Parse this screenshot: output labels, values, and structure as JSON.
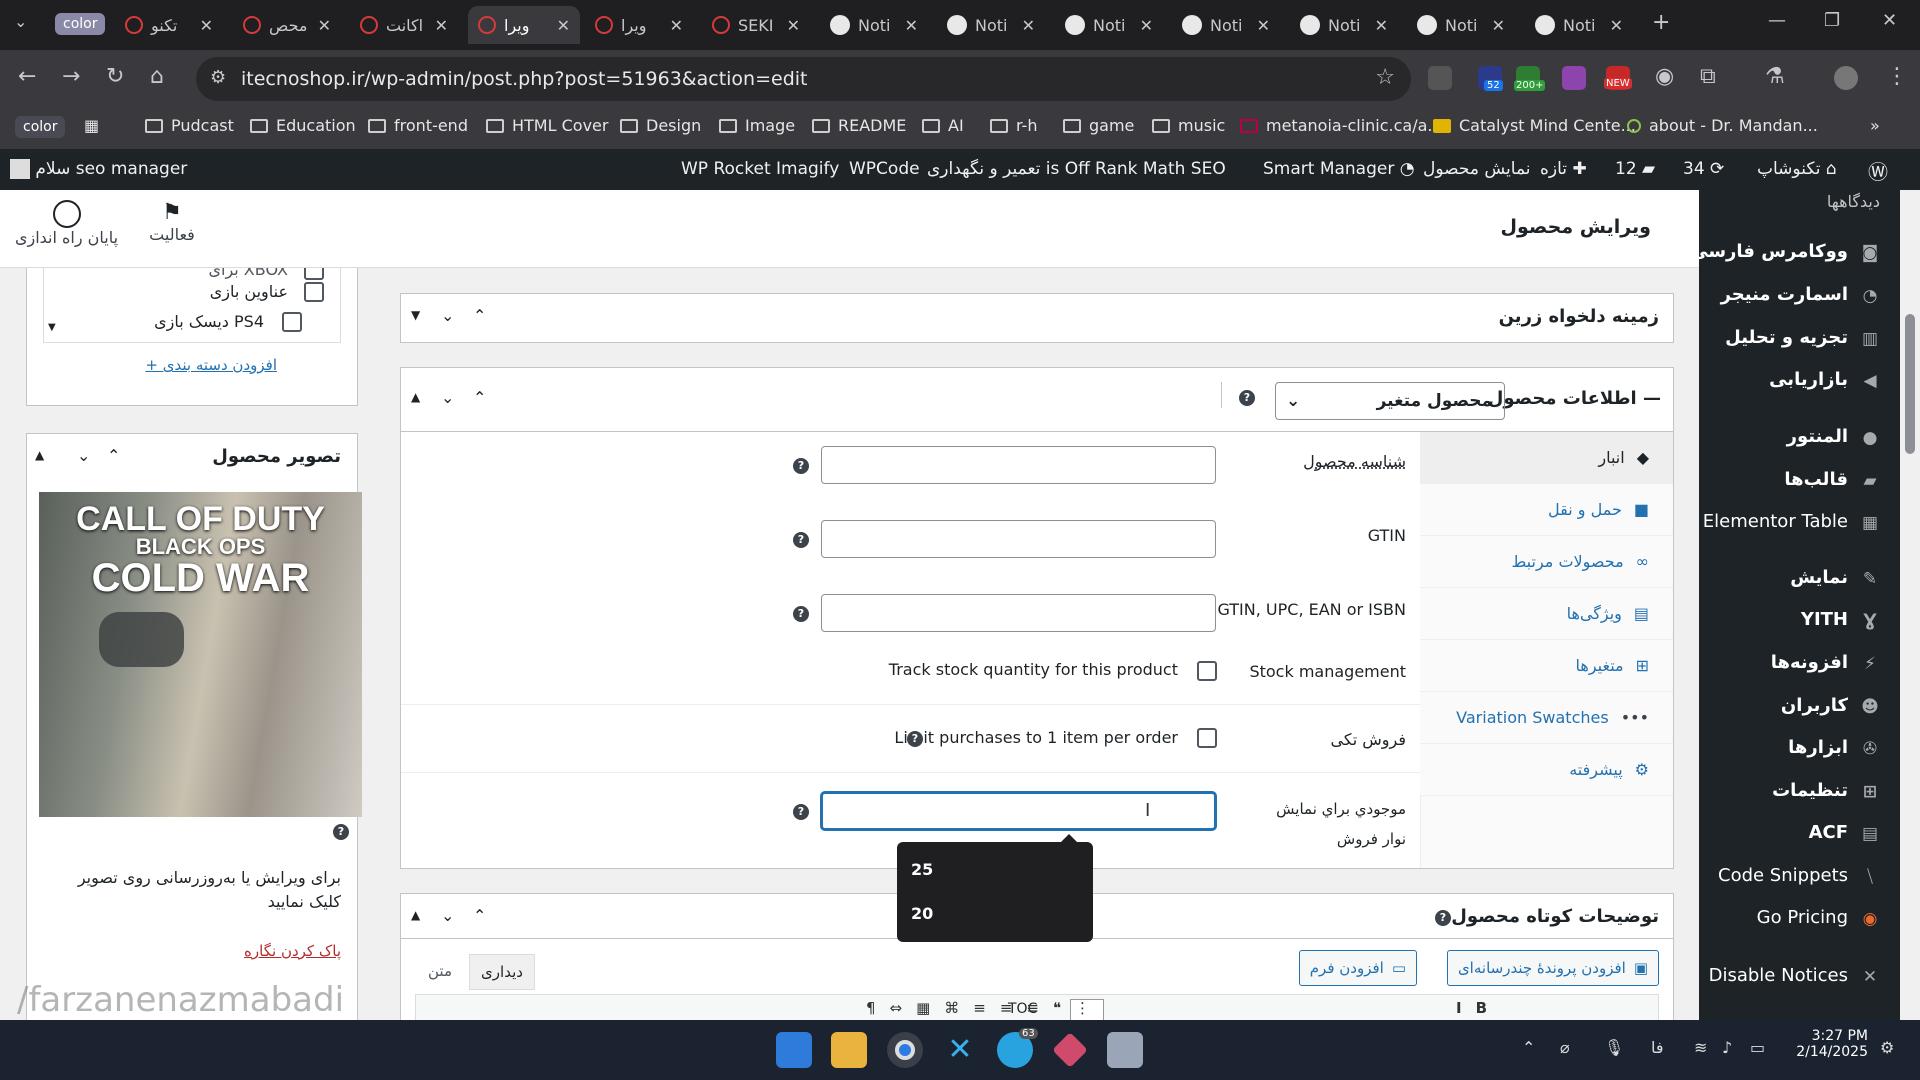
{
  "browser": {
    "tabs": [
      {
        "label": "color",
        "type": "group"
      },
      {
        "label": "تکنو",
        "icon": "wp"
      },
      {
        "label": "محص",
        "icon": "wp"
      },
      {
        "label": "اکانت",
        "icon": "wp"
      },
      {
        "label": "ویرا",
        "icon": "wp",
        "active": true
      },
      {
        "label": "ویرا",
        "icon": "wp"
      },
      {
        "label": "SEKI",
        "icon": "wp"
      },
      {
        "label": "Noti",
        "icon": "github"
      },
      {
        "label": "Noti",
        "icon": "github"
      },
      {
        "label": "Noti",
        "icon": "github"
      },
      {
        "label": "Noti",
        "icon": "github"
      },
      {
        "label": "Noti",
        "icon": "github"
      },
      {
        "label": "Noti",
        "icon": "github"
      },
      {
        "label": "Noti",
        "icon": "github"
      }
    ],
    "url": "itecnoshop.ir/wp-admin/post.php?post=51963&action=edit",
    "ext_badges": {
      "e1": "52",
      "e2": "200+",
      "e3": "NEW"
    },
    "bookmarks": [
      {
        "label": "color",
        "type": "group"
      },
      {
        "label": "Pudcast"
      },
      {
        "label": "Education"
      },
      {
        "label": "front-end"
      },
      {
        "label": "HTML Cover"
      },
      {
        "label": "Design"
      },
      {
        "label": "Image"
      },
      {
        "label": "README"
      },
      {
        "label": "AI"
      },
      {
        "label": "r-h"
      },
      {
        "label": "game"
      },
      {
        "label": "music"
      },
      {
        "label": "metanoia-clinic.ca/a..."
      },
      {
        "label": "Catalyst Mind Cente..."
      },
      {
        "label": "about - Dr. Mandan..."
      }
    ]
  },
  "adminbar": {
    "site": "تکنوشاپ",
    "updates": "34",
    "comments": "12",
    "new": "تازه",
    "view": "نمایش محصول",
    "smart": "Smart Manager",
    "rankmath": "Rank Math SEO",
    "maint": "تعمیر و نگهداری is Off",
    "wpcode": "WPCode",
    "imagify": "Imagify",
    "rocket": "WP Rocket",
    "greeting": "سلام seo manager"
  },
  "sidebar": {
    "items": [
      {
        "label": "دیدگاهها"
      },
      {
        "label": "ووکامرس فارسی"
      },
      {
        "label": "اسمارت منیجر"
      },
      {
        "label": "تجزیه و تحلیل"
      },
      {
        "label": "بازاریابی"
      },
      {
        "label": "المنتور"
      },
      {
        "label": "قالب‌ها"
      },
      {
        "label": "Elementor Table"
      },
      {
        "label": "نمایش"
      },
      {
        "label": "YITH"
      },
      {
        "label": "افزونه‌ها"
      },
      {
        "label": "کاربران"
      },
      {
        "label": "ابزارها"
      },
      {
        "label": "تنظیمات"
      },
      {
        "label": "ACF"
      },
      {
        "label": "Code Snippets"
      },
      {
        "label": "Go Pricing"
      },
      {
        "label": "Disable Notices"
      }
    ]
  },
  "header": {
    "title": "ویرایش محصول",
    "activity": "فعالیت",
    "end_setup": "پایان راه اندازی"
  },
  "categories": {
    "items": [
      {
        "label": "برای XBOX"
      },
      {
        "label": "عناوین بازی"
      },
      {
        "label": "دیسک بازی PS4"
      }
    ],
    "add": "+ افزودن دسته بندی"
  },
  "product_image": {
    "title": "تصویر محصول",
    "poster_line1": "CALL OF DUTY",
    "poster_line2": "BLACK OPS",
    "poster_line3": "COLD WAR",
    "hint": "برای ویرایش یا به‌روزرسانی روی تصویر کلیک نمایید",
    "remove": "پاک کردن نگاره",
    "watermark": "/farzanenazmabadi"
  },
  "custom_field": {
    "title": "زمینه دلخواه زرین"
  },
  "product_data": {
    "title": "اطلاعات محصول —",
    "type": "محصول متغیر",
    "tabs": [
      {
        "label": "انبار"
      },
      {
        "label": "حمل و نقل"
      },
      {
        "label": "محصولات مرتبط"
      },
      {
        "label": "ویژگی‌ها"
      },
      {
        "label": "متغیرها"
      },
      {
        "label": "Variation Swatches"
      },
      {
        "label": "پیشرفته"
      }
    ],
    "sku_label": "شناسه محصول",
    "gtin_label": "GTIN",
    "gtin2_label": "GTIN, UPC, EAN or ISBN",
    "stock_label": "Stock management",
    "stock_check": "Track stock quantity for this product",
    "sold_label": "فروش تکی",
    "sold_check": "Limit purchases to 1 item per order",
    "display_label": "موجودي براي نمايش نوار فروش",
    "display_value": "",
    "suggestions": [
      "25",
      "20"
    ]
  },
  "short_desc": {
    "title": "توضیحات کوتاه محصول",
    "add_media": "افزودن پروندهٔ چندرسانه‌ای",
    "add_form": "افزودن فرم",
    "tab_visual": "دیداری",
    "tab_text": "متن",
    "toc": "TOC"
  },
  "taskbar": {
    "lang": "فا",
    "time": "3:27 PM",
    "date": "2/14/2025",
    "telegram_badge": "63"
  }
}
